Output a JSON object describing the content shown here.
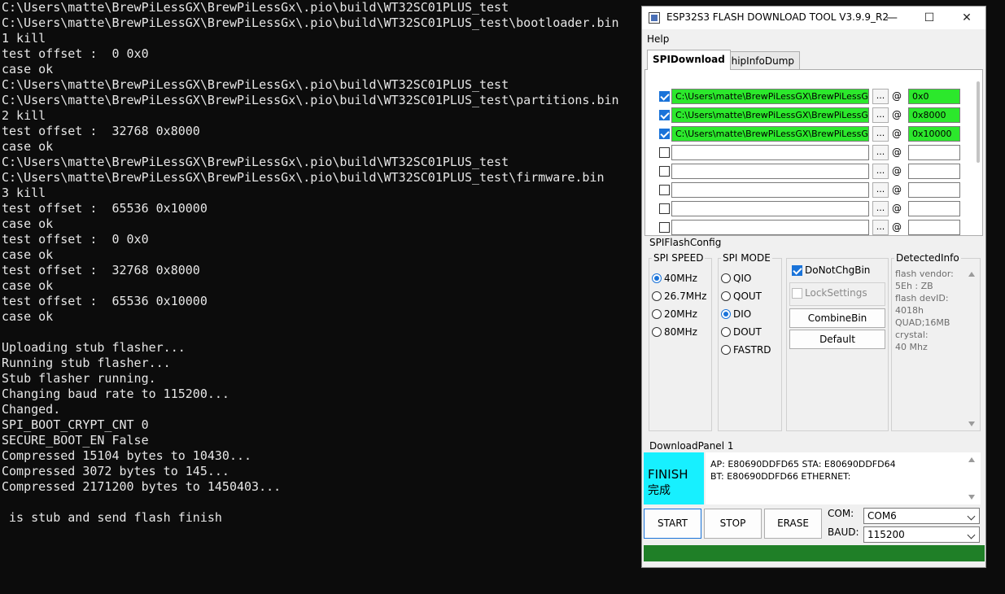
{
  "console": {
    "lines": [
      "C:\\Users\\matte\\BrewPiLessGX\\BrewPiLessGx\\.pio\\build\\WT32SC01PLUS_test",
      "C:\\Users\\matte\\BrewPiLessGX\\BrewPiLessGx\\.pio\\build\\WT32SC01PLUS_test\\bootloader.bin",
      "1 kill",
      "test offset :  0 0x0",
      "case ok",
      "C:\\Users\\matte\\BrewPiLessGX\\BrewPiLessGx\\.pio\\build\\WT32SC01PLUS_test",
      "C:\\Users\\matte\\BrewPiLessGX\\BrewPiLessGx\\.pio\\build\\WT32SC01PLUS_test\\partitions.bin",
      "2 kill",
      "test offset :  32768 0x8000",
      "case ok",
      "C:\\Users\\matte\\BrewPiLessGX\\BrewPiLessGx\\.pio\\build\\WT32SC01PLUS_test",
      "C:\\Users\\matte\\BrewPiLessGX\\BrewPiLessGx\\.pio\\build\\WT32SC01PLUS_test\\firmware.bin",
      "3 kill",
      "test offset :  65536 0x10000",
      "case ok",
      "test offset :  0 0x0",
      "case ok",
      "test offset :  32768 0x8000",
      "case ok",
      "test offset :  65536 0x10000",
      "case ok",
      "",
      "Uploading stub flasher...",
      "Running stub flasher...",
      "Stub flasher running.",
      "Changing baud rate to 115200...",
      "Changed.",
      "SPI_BOOT_CRYPT_CNT 0",
      "SECURE_BOOT_EN False",
      "Compressed 15104 bytes to 10430...",
      "Compressed 3072 bytes to 145...",
      "Compressed 2171200 bytes to 1450403...",
      "",
      " is stub and send flash finish"
    ]
  },
  "window": {
    "title": "ESP32S3 FLASH DOWNLOAD TOOL V3.9.9_R2",
    "controls": {
      "minimize": "—",
      "maximize": "☐",
      "close": "✕"
    },
    "menu": {
      "help": "Help"
    },
    "tabs": [
      {
        "label": "SPIDownload"
      },
      {
        "label": "chipInfoDump"
      }
    ],
    "files": [
      {
        "checked": true,
        "path": "C:\\Users\\matte\\BrewPiLessGX\\BrewPiLessGx\\",
        "address": "0x0",
        "highlight": true
      },
      {
        "checked": true,
        "path": "C:\\Users\\matte\\BrewPiLessGX\\BrewPiLessGx\\",
        "address": "0x8000",
        "highlight": true
      },
      {
        "checked": true,
        "path": "C:\\Users\\matte\\BrewPiLessGX\\BrewPiLessGx\\",
        "address": "0x10000",
        "highlight": true
      },
      {
        "checked": false,
        "path": "",
        "address": "",
        "highlight": false
      },
      {
        "checked": false,
        "path": "",
        "address": "",
        "highlight": false
      },
      {
        "checked": false,
        "path": "",
        "address": "",
        "highlight": false
      },
      {
        "checked": false,
        "path": "",
        "address": "",
        "highlight": false
      },
      {
        "checked": false,
        "path": "",
        "address": "",
        "highlight": false
      }
    ],
    "browse_label": "...",
    "at_label": "@",
    "spi_flash_config": {
      "label": "SPIFlashConfig",
      "spi_speed": {
        "label": "SPI SPEED",
        "options": [
          "40MHz",
          "26.7MHz",
          "20MHz",
          "80MHz"
        ],
        "selected": "40MHz"
      },
      "spi_mode": {
        "label": "SPI MODE",
        "options": [
          "QIO",
          "QOUT",
          "DIO",
          "DOUT",
          "FASTRD"
        ],
        "selected": "DIO"
      },
      "do_not_chg_bin": {
        "label": "DoNotChgBin",
        "checked": true
      },
      "lock_settings": {
        "label": "LockSettings",
        "checked": false
      },
      "combine_bin_label": "CombineBin",
      "default_label": "Default",
      "detected_info": {
        "label": "DetectedInfo",
        "lines": [
          "flash vendor:",
          "5Eh : ZB",
          "flash devID:",
          "4018h",
          "QUAD;16MB",
          "crystal:",
          "40 Mhz"
        ]
      }
    },
    "download_panel": {
      "label": "DownloadPanel 1",
      "status_en": "FINISH",
      "status_cn": "完成",
      "info_lines": [
        "AP:  E80690DDFD65  STA:  E80690DDFD64",
        "BT:  E80690DDFD66  ETHERNET:"
      ],
      "start_label": "START",
      "stop_label": "STOP",
      "erase_label": "ERASE",
      "com_label": "COM:",
      "com_value": "COM6",
      "baud_label": "BAUD:",
      "baud_value": "115200",
      "progress": 1.0
    },
    "colors": {
      "highlight_green": "#2ce82c",
      "finish_cyan": "#17f0ff",
      "progress_green": "#1f7f27",
      "accent_blue": "#1a73d9"
    }
  }
}
